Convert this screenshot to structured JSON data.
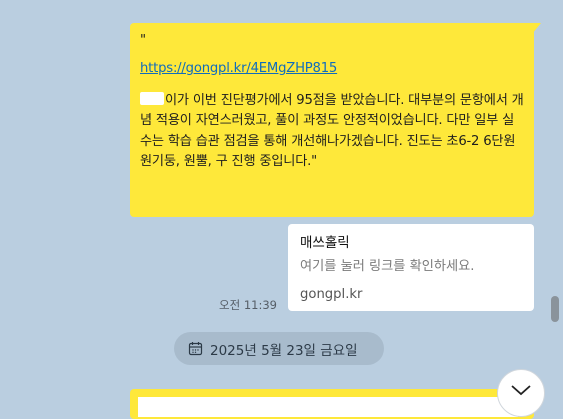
{
  "message": {
    "quote_open": "\"",
    "link": "https://gongpl.kr/4EMgZHP815",
    "body_text": "이가 이번 진단평가에서 95점을 받았습니다. 대부분의 문항에서 개념 적용이 자연스러웠고, 풀이 과정도 안정적이었습니다. 다만 일부 실수는 학습 습관 점검을 통해 개선해나가겠습니다. 진도는 초6-2  6단원 원기둥, 원뿔, 구 진행 중입니다.\""
  },
  "link_preview": {
    "title": "매쓰홀릭",
    "description": "여기를 눌러 링크를 확인하세요.",
    "domain": "gongpl.kr"
  },
  "timestamp": "오전 11:39",
  "date_divider": "2025년 5월 23일 금요일",
  "colors": {
    "chat_background": "#bacee0",
    "my_bubble": "#fee83a",
    "link_color": "#0f6cbd"
  },
  "icons": {
    "date": "calendar-icon",
    "scroll": "chevron-down-icon"
  }
}
